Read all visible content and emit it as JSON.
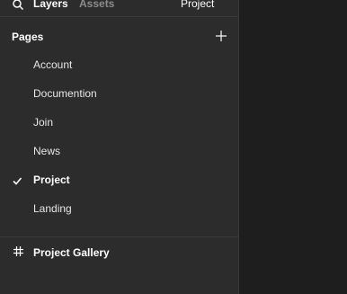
{
  "toolbar": {
    "layers_label": "Layers",
    "assets_label": "Assets",
    "page_select_label": "Project"
  },
  "pages": {
    "title": "Pages",
    "items": [
      {
        "label": "Account",
        "current": false
      },
      {
        "label": "Documention",
        "current": false
      },
      {
        "label": "Join",
        "current": false
      },
      {
        "label": "News",
        "current": false
      },
      {
        "label": "Project",
        "current": true
      },
      {
        "label": "Landing",
        "current": false
      }
    ]
  },
  "gallery": {
    "label": "Project Gallery"
  },
  "colors": {
    "panel_bg": "#2c2c2c",
    "canvas_bg": "#1e1e1e",
    "divider": "#3a3a3a",
    "text_primary": "#ffffff",
    "text_muted": "#8c8c8c"
  },
  "icons": {
    "search": "search-icon",
    "add": "plus-icon",
    "check": "check-icon",
    "frame": "hash-icon"
  }
}
